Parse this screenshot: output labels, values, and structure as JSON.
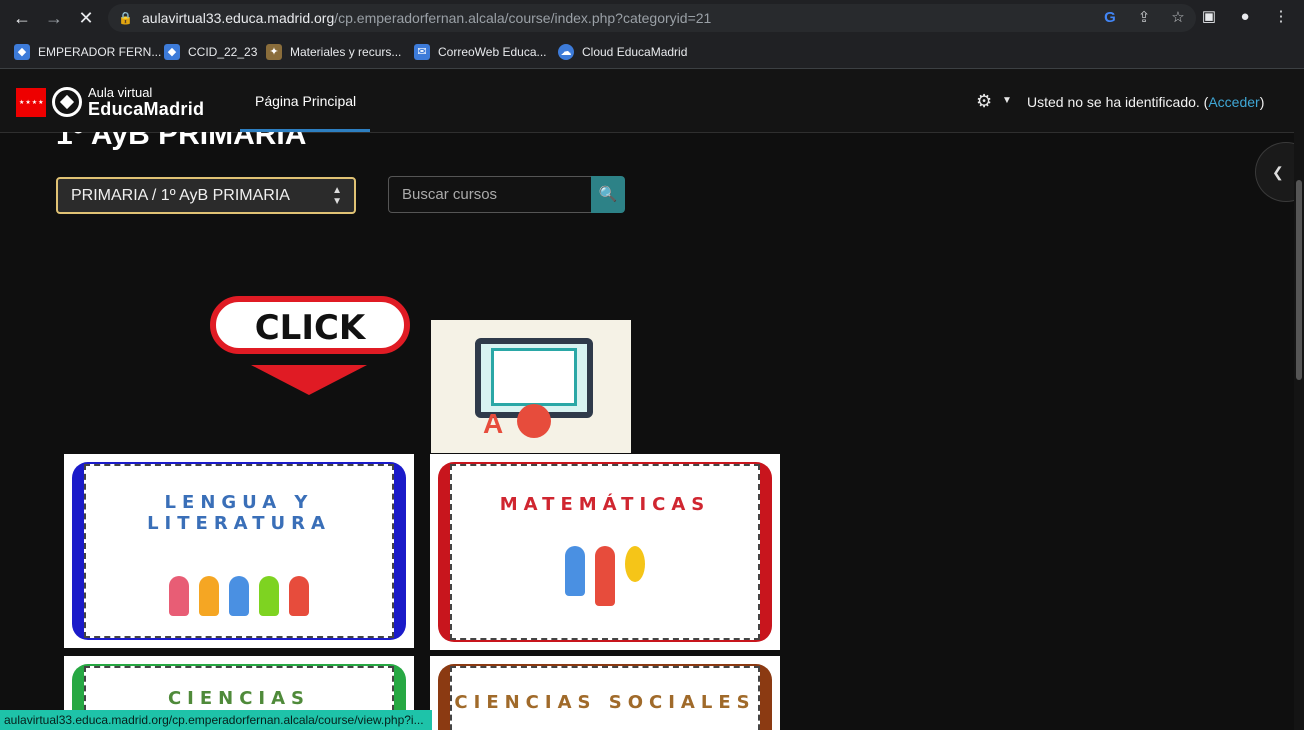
{
  "browser": {
    "url_host": "aulavirtual33.educa.madrid.org",
    "url_path": "/cp.emperadorfernan.alcala/course/index.php?categoryid=21",
    "bookmarks": [
      {
        "label": "EMPERADOR FERN...",
        "icon": "layers-icon"
      },
      {
        "label": "CCID_22_23",
        "icon": "layers-icon"
      },
      {
        "label": "Materiales y recurs...",
        "icon": "figure-icon"
      },
      {
        "label": "CorreoWeb Educa...",
        "icon": "mail-icon"
      },
      {
        "label": "Cloud EducaMadrid",
        "icon": "cloud-icon"
      }
    ],
    "status_url": "aulavirtual33.educa.madrid.org/cp.emperadorfernan.alcala/course/view.php?i..."
  },
  "site": {
    "logo_small": "Aula virtual",
    "logo_big": "EducaMadrid",
    "nav_home": "Página Principal",
    "login_prefix": "Usted no se ha identificado. (",
    "login_link": "Acceder",
    "login_suffix": ")"
  },
  "page": {
    "title": "1º AyB PRIMARIA",
    "category_select": "PRIMARIA / 1º AyB PRIMARIA",
    "search_placeholder": "Buscar cursos",
    "click_banner": "CLICK"
  },
  "courses": [
    {
      "title": "LENGUA Y LITERATURA",
      "border_color": "#1b1bc9",
      "tile_color": "#3a6fb8"
    },
    {
      "title": "MATEMÁTICAS",
      "border_color": "#c8151d",
      "tile_color": "#d02630"
    },
    {
      "title": "CIENCIAS",
      "border_color": "#27a843",
      "tile_color": "#4f8a3a"
    },
    {
      "title": "CIENCIAS SOCIALES",
      "border_color": "#8b3a12",
      "tile_color": "#a06a2a"
    }
  ],
  "colors": {
    "accent": "#2d8287",
    "link": "#3fa7d6",
    "select_border": "#e0c274"
  }
}
